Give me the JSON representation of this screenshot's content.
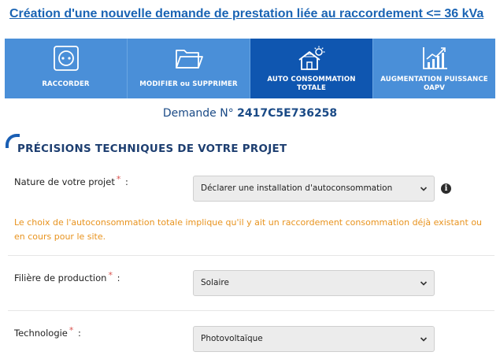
{
  "page_title": "Création d'une nouvelle demande de prestation liée au raccordement <= 36 kVa",
  "tabs": [
    {
      "label": "RACCORDER",
      "icon": "socket-icon",
      "active": false
    },
    {
      "label": "MODIFIER ou SUPPRIMER",
      "icon": "folder-icon",
      "active": false
    },
    {
      "label_line1": "AUTO CONSOMMATION",
      "label_line2": "TOTALE",
      "icon": "solar-house-icon",
      "active": true
    },
    {
      "label_line1": "AUGMENTATION PUISSANCE",
      "label_line2": "OAPV",
      "icon": "growth-chart-icon",
      "active": false
    }
  ],
  "demande": {
    "prefix": "Demande N°",
    "number": "2417C5E736258"
  },
  "section_title": "PRÉCISIONS TECHNIQUES DE VOTRE PROJET",
  "fields": {
    "nature": {
      "label": "Nature de votre projet",
      "required_mark": "*",
      "colon": ":",
      "value": "Déclarer une installation d'autoconsommation"
    },
    "filiere": {
      "label": "Filière de production",
      "required_mark": "*",
      "colon": ":",
      "value": "Solaire"
    },
    "technologie": {
      "label": "Technologie",
      "required_mark": "*",
      "colon": ":",
      "value": "Photovoltaïque"
    }
  },
  "info_glyph": "i",
  "warning_text": "Le choix de l'autoconsommation totale implique qu'il y ait un raccordement consommation déjà existant ou en cours pour le site.",
  "colors": {
    "tab_bg": "#4a8fd8",
    "tab_active_bg": "#0f56b0",
    "title_blue": "#1a64b4",
    "warning_orange": "#e8931e",
    "required_red": "#d9534f"
  }
}
